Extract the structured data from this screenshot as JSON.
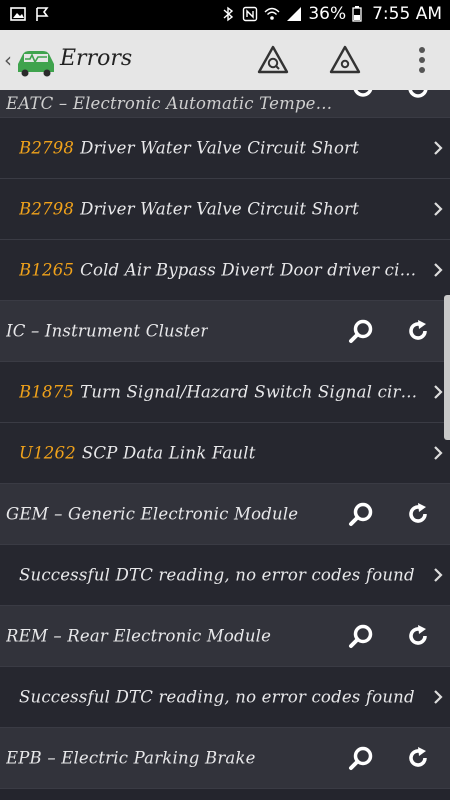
{
  "status_bar": {
    "battery": "36%",
    "time": "7:55 AM",
    "icons": [
      "gallery-icon",
      "flag-icon",
      "bluetooth-icon",
      "nfc-icon",
      "wifi-icon",
      "signal-icon",
      "battery-icon"
    ]
  },
  "appbar": {
    "title": "Errors",
    "icons": [
      "back-arrow-icon",
      "car-diagnostic-logo-icon",
      "warning-scan-icon",
      "warning-icon",
      "more-vert-icon"
    ]
  },
  "list": [
    {
      "type": "module",
      "partial": true,
      "name": "EATC – Electronic Automatic Tempera..."
    },
    {
      "type": "error",
      "code": "B2798",
      "description": "Driver Water Valve Circuit Short"
    },
    {
      "type": "error",
      "code": "B2798",
      "description": "Driver Water Valve Circuit Short"
    },
    {
      "type": "error",
      "code": "B1265",
      "description": "Cold Air Bypass Divert Door driver circuit f..."
    },
    {
      "type": "module",
      "name": "IC – Instrument Cluster"
    },
    {
      "type": "error",
      "code": "B1875",
      "description": "Turn Signal/Hazard Switch Signal circuit f..."
    },
    {
      "type": "error",
      "code": "U1262",
      "description": "SCP Data Link Fault"
    },
    {
      "type": "module",
      "name": "GEM – Generic Electronic Module"
    },
    {
      "type": "info",
      "description": "Successful DTC reading, no error codes found"
    },
    {
      "type": "module",
      "name": "REM – Rear Electronic Module"
    },
    {
      "type": "info",
      "description": "Successful DTC reading, no error codes found"
    },
    {
      "type": "module",
      "name": "EPB – Electric Parking Brake"
    }
  ],
  "colors": {
    "code": "#f0a21b",
    "background": "#24252d",
    "module_row": "#32333b",
    "appbar": "#e6e6e6"
  }
}
